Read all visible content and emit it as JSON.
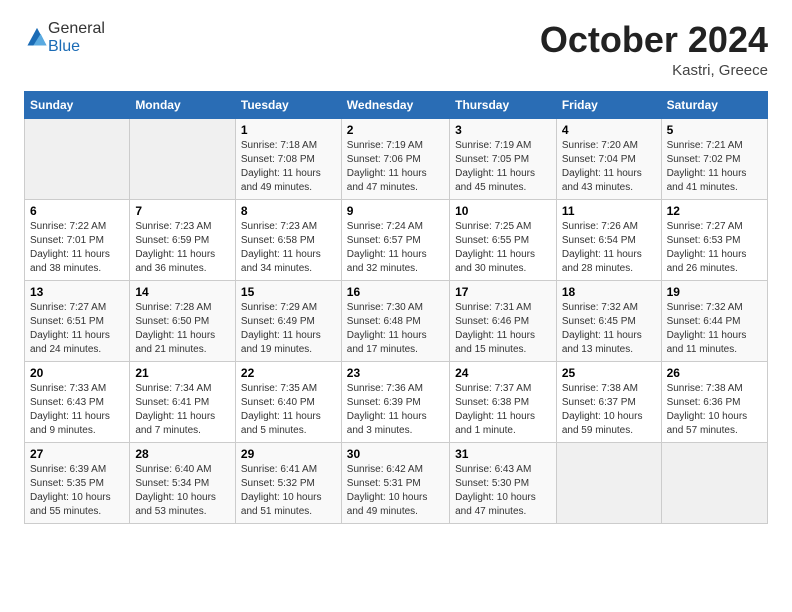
{
  "logo": {
    "general": "General",
    "blue": "Blue"
  },
  "header": {
    "title": "October 2024",
    "location": "Kastri, Greece"
  },
  "columns": [
    "Sunday",
    "Monday",
    "Tuesday",
    "Wednesday",
    "Thursday",
    "Friday",
    "Saturday"
  ],
  "weeks": [
    [
      {
        "day": "",
        "info": ""
      },
      {
        "day": "",
        "info": ""
      },
      {
        "day": "1",
        "info": "Sunrise: 7:18 AM\nSunset: 7:08 PM\nDaylight: 11 hours and 49 minutes."
      },
      {
        "day": "2",
        "info": "Sunrise: 7:19 AM\nSunset: 7:06 PM\nDaylight: 11 hours and 47 minutes."
      },
      {
        "day": "3",
        "info": "Sunrise: 7:19 AM\nSunset: 7:05 PM\nDaylight: 11 hours and 45 minutes."
      },
      {
        "day": "4",
        "info": "Sunrise: 7:20 AM\nSunset: 7:04 PM\nDaylight: 11 hours and 43 minutes."
      },
      {
        "day": "5",
        "info": "Sunrise: 7:21 AM\nSunset: 7:02 PM\nDaylight: 11 hours and 41 minutes."
      }
    ],
    [
      {
        "day": "6",
        "info": "Sunrise: 7:22 AM\nSunset: 7:01 PM\nDaylight: 11 hours and 38 minutes."
      },
      {
        "day": "7",
        "info": "Sunrise: 7:23 AM\nSunset: 6:59 PM\nDaylight: 11 hours and 36 minutes."
      },
      {
        "day": "8",
        "info": "Sunrise: 7:23 AM\nSunset: 6:58 PM\nDaylight: 11 hours and 34 minutes."
      },
      {
        "day": "9",
        "info": "Sunrise: 7:24 AM\nSunset: 6:57 PM\nDaylight: 11 hours and 32 minutes."
      },
      {
        "day": "10",
        "info": "Sunrise: 7:25 AM\nSunset: 6:55 PM\nDaylight: 11 hours and 30 minutes."
      },
      {
        "day": "11",
        "info": "Sunrise: 7:26 AM\nSunset: 6:54 PM\nDaylight: 11 hours and 28 minutes."
      },
      {
        "day": "12",
        "info": "Sunrise: 7:27 AM\nSunset: 6:53 PM\nDaylight: 11 hours and 26 minutes."
      }
    ],
    [
      {
        "day": "13",
        "info": "Sunrise: 7:27 AM\nSunset: 6:51 PM\nDaylight: 11 hours and 24 minutes."
      },
      {
        "day": "14",
        "info": "Sunrise: 7:28 AM\nSunset: 6:50 PM\nDaylight: 11 hours and 21 minutes."
      },
      {
        "day": "15",
        "info": "Sunrise: 7:29 AM\nSunset: 6:49 PM\nDaylight: 11 hours and 19 minutes."
      },
      {
        "day": "16",
        "info": "Sunrise: 7:30 AM\nSunset: 6:48 PM\nDaylight: 11 hours and 17 minutes."
      },
      {
        "day": "17",
        "info": "Sunrise: 7:31 AM\nSunset: 6:46 PM\nDaylight: 11 hours and 15 minutes."
      },
      {
        "day": "18",
        "info": "Sunrise: 7:32 AM\nSunset: 6:45 PM\nDaylight: 11 hours and 13 minutes."
      },
      {
        "day": "19",
        "info": "Sunrise: 7:32 AM\nSunset: 6:44 PM\nDaylight: 11 hours and 11 minutes."
      }
    ],
    [
      {
        "day": "20",
        "info": "Sunrise: 7:33 AM\nSunset: 6:43 PM\nDaylight: 11 hours and 9 minutes."
      },
      {
        "day": "21",
        "info": "Sunrise: 7:34 AM\nSunset: 6:41 PM\nDaylight: 11 hours and 7 minutes."
      },
      {
        "day": "22",
        "info": "Sunrise: 7:35 AM\nSunset: 6:40 PM\nDaylight: 11 hours and 5 minutes."
      },
      {
        "day": "23",
        "info": "Sunrise: 7:36 AM\nSunset: 6:39 PM\nDaylight: 11 hours and 3 minutes."
      },
      {
        "day": "24",
        "info": "Sunrise: 7:37 AM\nSunset: 6:38 PM\nDaylight: 11 hours and 1 minute."
      },
      {
        "day": "25",
        "info": "Sunrise: 7:38 AM\nSunset: 6:37 PM\nDaylight: 10 hours and 59 minutes."
      },
      {
        "day": "26",
        "info": "Sunrise: 7:38 AM\nSunset: 6:36 PM\nDaylight: 10 hours and 57 minutes."
      }
    ],
    [
      {
        "day": "27",
        "info": "Sunrise: 6:39 AM\nSunset: 5:35 PM\nDaylight: 10 hours and 55 minutes."
      },
      {
        "day": "28",
        "info": "Sunrise: 6:40 AM\nSunset: 5:34 PM\nDaylight: 10 hours and 53 minutes."
      },
      {
        "day": "29",
        "info": "Sunrise: 6:41 AM\nSunset: 5:32 PM\nDaylight: 10 hours and 51 minutes."
      },
      {
        "day": "30",
        "info": "Sunrise: 6:42 AM\nSunset: 5:31 PM\nDaylight: 10 hours and 49 minutes."
      },
      {
        "day": "31",
        "info": "Sunrise: 6:43 AM\nSunset: 5:30 PM\nDaylight: 10 hours and 47 minutes."
      },
      {
        "day": "",
        "info": ""
      },
      {
        "day": "",
        "info": ""
      }
    ]
  ]
}
